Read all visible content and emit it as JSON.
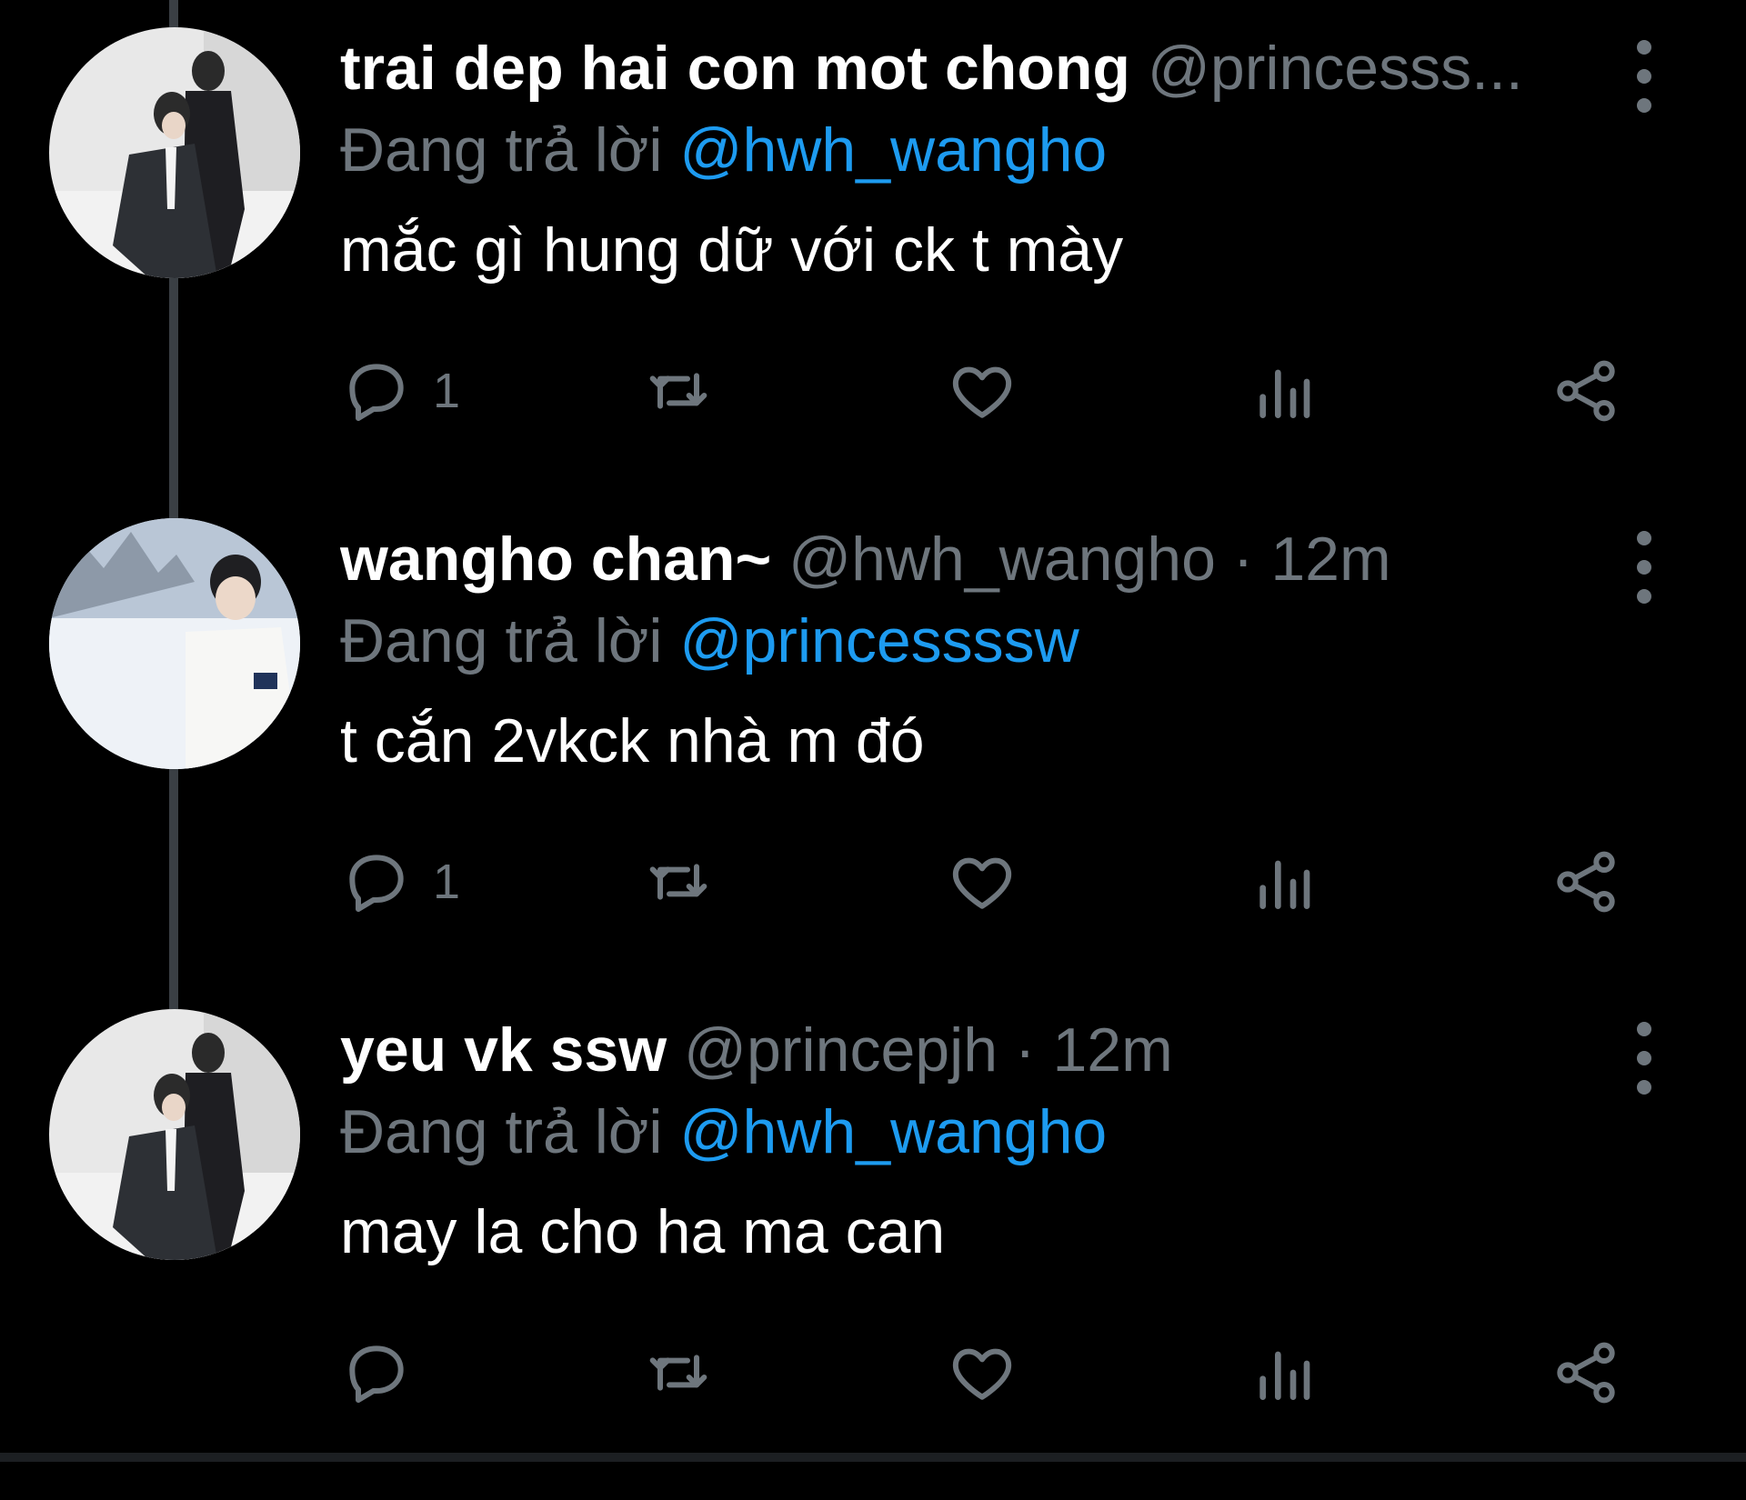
{
  "tweets": [
    {
      "display_name": "trai dep hai con mot chong",
      "handle": "@princesss...",
      "dot": "",
      "time": "",
      "reply_prefix": "Đang trả lời",
      "reply_to": "@hwh_wangho",
      "text": "mắc gì hung dữ với ck t mày",
      "reply_count": "1",
      "icons": [
        "reply-icon",
        "retweet-icon",
        "like-icon",
        "views-icon",
        "share-icon",
        "more-options-icon"
      ]
    },
    {
      "display_name": "wangho chan~",
      "handle": "@hwh_wangho",
      "dot": "·",
      "time": "12m",
      "reply_prefix": "Đang trả lời",
      "reply_to": "@princessssw",
      "text": "t cắn 2vkck nhà m đó",
      "reply_count": "1",
      "icons": [
        "reply-icon",
        "retweet-icon",
        "like-icon",
        "views-icon",
        "share-icon",
        "more-options-icon"
      ]
    },
    {
      "display_name": "yeu vk ssw",
      "handle": "@princepjh",
      "dot": "·",
      "time": "12m",
      "reply_prefix": "Đang trả lời",
      "reply_to": "@hwh_wangho",
      "text": "may la cho ha ma can",
      "reply_count": "",
      "icons": [
        "reply-icon",
        "retweet-icon",
        "like-icon",
        "views-icon",
        "share-icon",
        "more-options-icon"
      ]
    }
  ],
  "colors": {
    "background": "#000000",
    "text_primary": "#ffffff",
    "text_secondary": "#6e767d",
    "link": "#1d9bf0",
    "thread_line": "#3a3f44"
  }
}
